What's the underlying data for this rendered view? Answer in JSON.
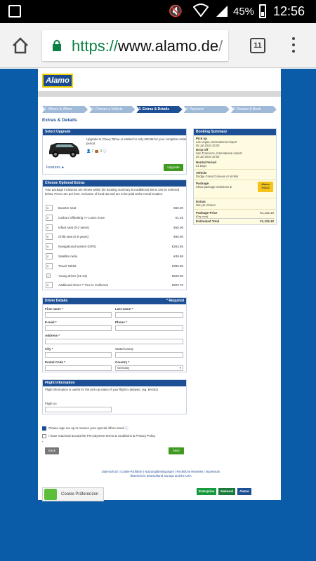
{
  "status_bar": {
    "battery": "45%",
    "time": "12:56"
  },
  "browser": {
    "url_scheme": "https://",
    "url_host": "www.alamo.de",
    "url_path": "/",
    "tab_count": "11"
  },
  "site": {
    "logo": "Alamo",
    "steps": [
      "1. Where & When",
      "2. Choose a Vehicle",
      "3. Extras & Details",
      "4. Payment",
      "5. Review & Book"
    ],
    "active_step": 2,
    "page_title": "Extras & Details"
  },
  "upgrade": {
    "heading": "Select Upgrade",
    "text": "Upgrade to Chevy Tahoe or similar for only €60.65 for your complete rental period.",
    "seats": "7",
    "bags": "3",
    "features_link": "Features ►",
    "button": "Upgrade"
  },
  "extras": {
    "heading": "Choose Optional Extras",
    "intro": "Your package inclusions are shown within the booking summary but additional items can be selected below. Prices are per item, exclusive of local tax and are to be paid at the rental location.",
    "items": [
      {
        "qty": "0",
        "label": "Booster seat",
        "price": "€60.00"
      },
      {
        "qty": "0",
        "label": "Carbon Offsetting >> Learn more",
        "price": "€1.25"
      },
      {
        "qty": "0",
        "label": "Infant seat (0-2 years)",
        "price": "€60.00"
      },
      {
        "qty": "0",
        "label": "Child seat (2-5 years)",
        "price": "€60.00"
      },
      {
        "qty": "0",
        "label": "Navigational system (GPS)",
        "price": "€263.85"
      },
      {
        "qty": "0",
        "label": "Satellite radio",
        "price": "€49.86"
      },
      {
        "qty": "0",
        "label": "Travel Tablet",
        "price": "€299.85"
      },
      {
        "qty": "",
        "label": "Young driver (21-24)",
        "price": "€525.00"
      },
      {
        "qty": "0",
        "label": "Additional driver ** free in California",
        "price": "€203.70"
      }
    ]
  },
  "driver": {
    "heading": "Driver Details",
    "required_note": "* Required",
    "labels": {
      "first_name": "First name *",
      "last_name": "Last name *",
      "email": "E-mail *",
      "phone": "Phone *",
      "address": "Address *",
      "city": "City *",
      "state": "State/County",
      "postal": "Postal Code *",
      "country": "Country *"
    },
    "country_value": "Germany"
  },
  "flight": {
    "heading": "Flight Information",
    "text": "Flight information is useful for the pick up station if your flight is delayed. (eg. BA452)",
    "label": "Flight no"
  },
  "consent": {
    "newsletter": "Please sign me up to receive your special offers email",
    "terms": "I have read and accept the Pre-payment terms & conditions & Privacy Policy",
    "required": "*"
  },
  "nav_buttons": {
    "back": "Back",
    "next": "Next"
  },
  "summary": {
    "heading": "Booking Summary",
    "pickup_label": "Pick up",
    "pickup_value": "Las Vegas, International Airport",
    "pickup_date": "05 Jul 2016 10:00",
    "dropoff_label": "Drop off",
    "dropoff_value": "San Francisco, International Airport",
    "dropoff_date": "26 Jul 2016 10:00",
    "period_label": "Rental Period",
    "period_value": "21 Days",
    "vehicle_label": "Vehicle",
    "vehicle_value": "Dodge Grand Caravan or similar",
    "package_label": "Package",
    "package_link": "Show package inclusions ►",
    "badge": "Alamo GOLD",
    "extras_label": "Extras",
    "extras_value": "Not yet chosen",
    "pkg_price_label": "Package Price",
    "pkg_price_sub": "(Pay now)",
    "pkg_price_value": "€1,115.10",
    "est_total_label": "Estimated Total",
    "est_total_value": "€1,115.10"
  },
  "footer": {
    "links_line1": "Datenschutz | Cookie-Richtlinie | Nutzungsbedingungen | Rechtliche Hinweise | Impressum",
    "links_line2": "Übersicht in Deutschland, Europa and the USA",
    "brands": [
      "Enterprise",
      "National",
      "Alamo"
    ],
    "cookie_button": "Cookie Präferenzen"
  },
  "colors": {
    "brand_blue": "#1d4f95",
    "page_bg": "#0a5ba8",
    "accent_green": "#3f9a1f",
    "gold": "#f3c31a"
  }
}
